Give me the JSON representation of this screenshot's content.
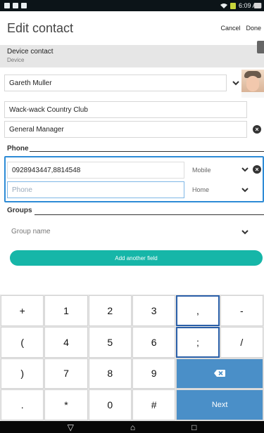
{
  "status_bar": {
    "time": "6:09 AM"
  },
  "header": {
    "title": "Edit contact",
    "cancel": "Cancel",
    "done": "Done"
  },
  "device": {
    "title": "Device contact",
    "subtitle": "Device"
  },
  "fields": {
    "name": "Gareth Muller",
    "company": "Wack-wack Country Club",
    "job_title": "General Manager"
  },
  "phone": {
    "section_label": "Phone",
    "entries": [
      {
        "value": "0928943447,8814548",
        "type": "Mobile"
      },
      {
        "placeholder": "Phone",
        "type": "Home"
      }
    ]
  },
  "groups": {
    "section_label": "Groups",
    "field": "Group name"
  },
  "add_field": "Add another field",
  "keyboard": {
    "rows": [
      [
        "+",
        "1",
        "2",
        "3",
        ",",
        "-"
      ],
      [
        "(",
        "4",
        "5",
        "6",
        ";",
        "/"
      ],
      [
        ")",
        "7",
        "8",
        "9"
      ],
      [
        ".",
        "*",
        "0",
        "#",
        "Next"
      ]
    ]
  },
  "colors": {
    "accent": "#16b6a8",
    "focus": "#2d8bd6",
    "keyboard_action": "#4a8fc8"
  }
}
